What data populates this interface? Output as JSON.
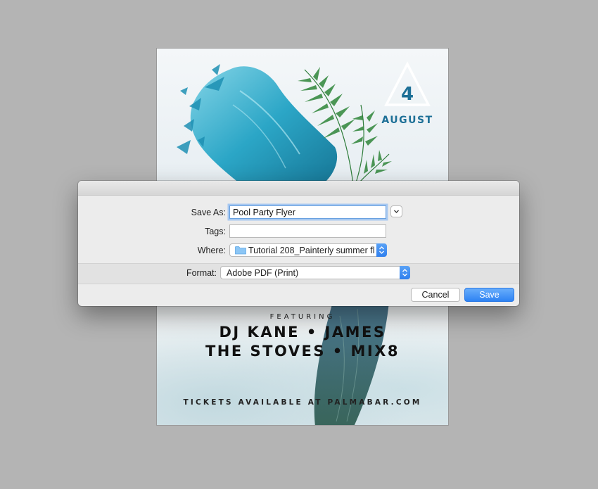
{
  "flyer": {
    "date_day": "4",
    "date_month": "AUGUST",
    "featuring": "FEATURING",
    "lineup_line1": "DJ KANE • JAMES",
    "lineup_line2": "THE STOVES • MIX8",
    "tickets": "TICKETS AVAILABLE AT PALMABAR.COM"
  },
  "dialog": {
    "save_as_label": "Save As:",
    "save_as_value": "Pool Party Flyer",
    "tags_label": "Tags:",
    "tags_value": "",
    "where_label": "Where:",
    "where_value": "Tutorial 208_Painterly summer fl...",
    "where_icon": "folder-icon",
    "format_label": "Format:",
    "format_value": "Adobe PDF (Print)",
    "cancel_label": "Cancel",
    "save_label": "Save"
  },
  "colors": {
    "accent_blue": "#2e82f3",
    "flyer_teal": "#1c6f96",
    "background": "#b4b4b4"
  }
}
